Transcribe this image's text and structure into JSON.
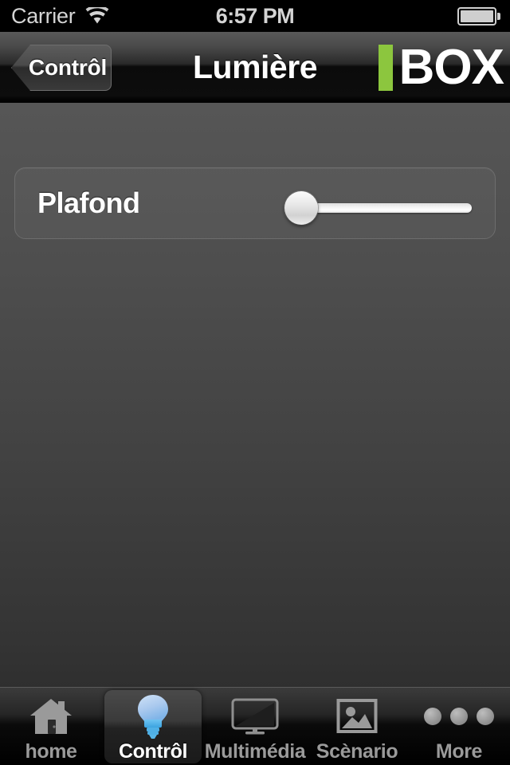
{
  "status_bar": {
    "carrier": "Carrier",
    "wifi_icon": "wifi-icon",
    "time": "6:57 PM",
    "battery_icon": "battery-icon"
  },
  "nav_bar": {
    "back_label": "Contrôl",
    "title": "Lumière",
    "logo_text": "BOX",
    "logo_accent_color": "#8cc63e"
  },
  "main": {
    "rows": [
      {
        "label": "Plafond",
        "control": "slider",
        "value": 0,
        "min": 0,
        "max": 100
      }
    ]
  },
  "tab_bar": {
    "items": [
      {
        "label": "home",
        "icon": "house-icon",
        "active": false
      },
      {
        "label": "Contrôl",
        "icon": "lightbulb-icon",
        "active": true
      },
      {
        "label": "Multimédia",
        "icon": "television-icon",
        "active": false
      },
      {
        "label": "Scènario",
        "icon": "photo-icon",
        "active": false
      },
      {
        "label": "More",
        "icon": "three-dots-icon",
        "active": false
      }
    ]
  }
}
